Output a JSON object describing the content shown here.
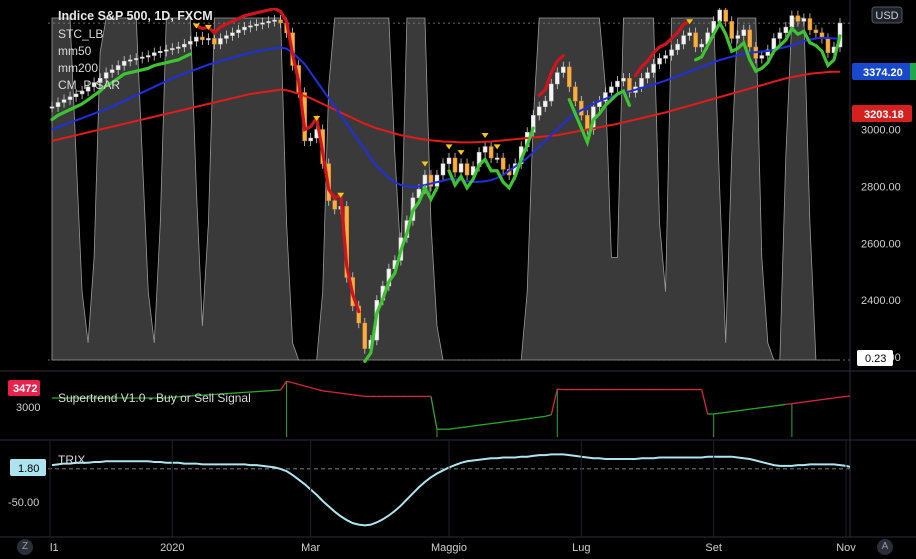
{
  "header": {
    "title": "Indice S&P 500, 1D, FXCM",
    "indicators": [
      "STC_LB",
      "mm50",
      "mm200",
      "CM_P-SAR"
    ],
    "currency": "USD"
  },
  "price_tags": {
    "last": "3374.20",
    "mm200": "3203.18",
    "stc": "0.23"
  },
  "supertrend": {
    "label": "Supertrend V1.0 - Buy or Sell Signal",
    "tag": "3472",
    "axis_label": "3000"
  },
  "trix": {
    "label": "TRIX",
    "tag": "1.80",
    "axis_label": "-50.00"
  },
  "corner": {
    "left": "Z",
    "right": "A"
  },
  "chart_data": {
    "type": "candlestick",
    "title": "Indice S&P 500, 1D, FXCM",
    "x_labels": [
      "l1",
      "2020",
      "Mar",
      "Maggio",
      "Lug",
      "Set",
      "Nov"
    ],
    "x_label_index": [
      0,
      20,
      43,
      66,
      88,
      110,
      132
    ],
    "y_ticks": [
      "3000.00",
      "2800.00",
      "2600.00",
      "2400.00",
      "2200.00"
    ],
    "y_tick_values": [
      3000,
      2800,
      2600,
      2400,
      2200
    ],
    "ylim": [
      2190,
      3420
    ],
    "price_series": [
      3080,
      3095,
      3105,
      3115,
      3125,
      3135,
      3150,
      3165,
      3180,
      3200,
      3210,
      3225,
      3240,
      3245,
      3250,
      3255,
      3260,
      3270,
      3275,
      3280,
      3285,
      3290,
      3300,
      3310,
      3325,
      3315,
      3320,
      3300,
      3320,
      3330,
      3340,
      3350,
      3360,
      3365,
      3370,
      3375,
      3380,
      3385,
      3375,
      3340,
      3225,
      3130,
      2960,
      2970,
      3000,
      2880,
      2750,
      2720,
      2730,
      2480,
      2380,
      2320,
      2230,
      2260,
      2400,
      2450,
      2510,
      2540,
      2620,
      2680,
      2760,
      2790,
      2840,
      2800,
      2840,
      2880,
      2900,
      2850,
      2880,
      2840,
      2870,
      2920,
      2940,
      2900,
      2900,
      2860,
      2840,
      2880,
      2940,
      2990,
      3050,
      3080,
      3100,
      3160,
      3200,
      3220,
      3150,
      3100,
      3050,
      3000,
      3080,
      3100,
      3130,
      3150,
      3170,
      3180,
      3130,
      3150,
      3180,
      3200,
      3230,
      3250,
      3260,
      3280,
      3300,
      3330,
      3340,
      3290,
      3300,
      3340,
      3380,
      3420,
      3380,
      3320,
      3330,
      3350,
      3290,
      3250,
      3260,
      3280,
      3320,
      3340,
      3360,
      3400,
      3380,
      3390,
      3350,
      3340,
      3320,
      3270,
      3290,
      3374
    ],
    "mm50": [
      3000,
      3008,
      3016,
      3024,
      3032,
      3040,
      3048,
      3056,
      3064,
      3072,
      3080,
      3090,
      3100,
      3110,
      3120,
      3130,
      3140,
      3150,
      3160,
      3170,
      3180,
      3188,
      3196,
      3204,
      3212,
      3220,
      3228,
      3234,
      3240,
      3246,
      3252,
      3258,
      3264,
      3270,
      3274,
      3278,
      3282,
      3286,
      3288,
      3284,
      3270,
      3250,
      3230,
      3200,
      3170,
      3140,
      3110,
      3080,
      3050,
      3020,
      2990,
      2960,
      2930,
      2900,
      2870,
      2850,
      2830,
      2815,
      2805,
      2800,
      2798,
      2800,
      2805,
      2810,
      2815,
      2820,
      2825,
      2825,
      2822,
      2818,
      2816,
      2816,
      2818,
      2822,
      2830,
      2840,
      2855,
      2870,
      2885,
      2900,
      2920,
      2940,
      2960,
      2980,
      3000,
      3020,
      3040,
      3055,
      3068,
      3078,
      3090,
      3100,
      3108,
      3116,
      3122,
      3128,
      3134,
      3140,
      3146,
      3152,
      3158,
      3165,
      3172,
      3180,
      3188,
      3196,
      3204,
      3212,
      3220,
      3228,
      3236,
      3244,
      3250,
      3256,
      3262,
      3266,
      3270,
      3272,
      3274,
      3276,
      3280,
      3285,
      3290,
      3296,
      3302,
      3310,
      3316,
      3320,
      3322,
      3322,
      3320,
      3320
    ],
    "mm200": [
      2960,
      2965,
      2970,
      2975,
      2980,
      2985,
      2990,
      2995,
      3000,
      3005,
      3010,
      3015,
      3020,
      3025,
      3030,
      3035,
      3040,
      3045,
      3050,
      3055,
      3060,
      3065,
      3070,
      3075,
      3080,
      3085,
      3090,
      3095,
      3100,
      3105,
      3110,
      3115,
      3120,
      3125,
      3128,
      3131,
      3134,
      3137,
      3140,
      3138,
      3132,
      3126,
      3118,
      3110,
      3100,
      3090,
      3080,
      3070,
      3060,
      3050,
      3040,
      3030,
      3020,
      3012,
      3004,
      2998,
      2992,
      2986,
      2980,
      2976,
      2972,
      2968,
      2965,
      2962,
      2960,
      2958,
      2957,
      2956,
      2955,
      2955,
      2955,
      2956,
      2957,
      2958,
      2960,
      2962,
      2964,
      2966,
      2968,
      2970,
      2972,
      2974,
      2976,
      2978,
      2980,
      2984,
      2988,
      2992,
      2996,
      3000,
      3004,
      3008,
      3012,
      3016,
      3020,
      3025,
      3030,
      3035,
      3040,
      3045,
      3050,
      3055,
      3060,
      3066,
      3072,
      3078,
      3084,
      3090,
      3096,
      3102,
      3108,
      3114,
      3120,
      3126,
      3132,
      3138,
      3144,
      3150,
      3156,
      3162,
      3168,
      3174,
      3180,
      3184,
      3188,
      3192,
      3196,
      3198,
      3200,
      3202,
      3203,
      3203
    ],
    "stc_ylim": [
      0,
      100
    ],
    "stc_values": [
      100,
      100,
      100,
      100,
      60,
      20,
      5,
      30,
      90,
      100,
      100,
      100,
      100,
      100,
      100,
      60,
      20,
      5,
      40,
      100,
      100,
      100,
      100,
      100,
      50,
      10,
      40,
      100,
      100,
      100,
      100,
      100,
      100,
      100,
      100,
      100,
      100,
      100,
      100,
      40,
      5,
      0,
      0,
      0,
      0,
      20,
      80,
      100,
      100,
      100,
      100,
      100,
      100,
      100,
      100,
      100,
      100,
      60,
      30,
      100,
      100,
      100,
      100,
      40,
      10,
      0,
      0,
      0,
      0,
      0,
      0,
      0,
      0,
      0,
      0,
      0,
      0,
      0,
      0,
      20,
      70,
      100,
      100,
      100,
      100,
      100,
      100,
      100,
      100,
      100,
      100,
      100,
      80,
      30,
      30,
      100,
      100,
      100,
      100,
      100,
      100,
      40,
      20,
      100,
      100,
      100,
      100,
      100,
      100,
      100,
      100,
      50,
      5,
      60,
      100,
      100,
      100,
      100,
      30,
      5,
      0,
      0,
      60,
      100,
      100,
      100,
      40,
      0,
      0,
      0,
      0,
      0
    ],
    "sar_up_ranges": [
      [
        0,
        23,
        3050
      ],
      [
        52,
        64,
        2220
      ],
      [
        66,
        80,
        2760
      ],
      [
        86,
        96,
        2980
      ],
      [
        107,
        132,
        3220
      ]
    ],
    "supertrend_ylim": [
      2800,
      3500
    ],
    "supertrend_values": [
      3250,
      3250,
      3250,
      3250,
      3250,
      3250,
      3250,
      3250,
      3250,
      3250,
      3250,
      3250,
      3250,
      3250,
      3250,
      3250,
      3250,
      3250,
      3250,
      3250,
      3260,
      3265,
      3270,
      3275,
      3280,
      3285,
      3290,
      3295,
      3300,
      3305,
      3310,
      3315,
      3320,
      3325,
      3330,
      3335,
      3340,
      3345,
      3350,
      3460,
      3440,
      3420,
      3400,
      3380,
      3360,
      3340,
      3330,
      3320,
      3310,
      3300,
      3290,
      3280,
      3270,
      3270,
      3270,
      3270,
      3270,
      3270,
      3270,
      3270,
      3270,
      3270,
      3270,
      3270,
      2860,
      2860,
      2860,
      2870,
      2880,
      2890,
      2900,
      2910,
      2920,
      2930,
      2940,
      2950,
      2960,
      2970,
      2980,
      2990,
      3000,
      3010,
      3020,
      3040,
      3360,
      3355,
      3355,
      3355,
      3355,
      3355,
      3355,
      3355,
      3355,
      3355,
      3355,
      3355,
      3355,
      3355,
      3355,
      3355,
      3355,
      3355,
      3355,
      3355,
      3355,
      3355,
      3355,
      3355,
      3355,
      3050,
      3050,
      3060,
      3070,
      3080,
      3090,
      3100,
      3110,
      3120,
      3130,
      3140,
      3150,
      3160,
      3170,
      3180,
      3190,
      3200,
      3210,
      3220,
      3230,
      3240,
      3250,
      3260,
      3270,
      3275,
      3280,
      3285
    ],
    "supertrend_flip": [
      39,
      64,
      84,
      110,
      123
    ],
    "trix_ylim": [
      -80,
      30
    ],
    "trix_values": [
      5,
      6,
      7,
      7,
      8,
      8,
      8,
      9,
      9,
      10,
      10,
      10,
      10,
      10,
      10,
      10,
      10,
      9,
      9,
      8,
      8,
      8,
      7,
      7,
      7,
      6,
      6,
      6,
      6,
      6,
      6,
      6,
      6,
      5,
      5,
      4,
      3,
      2,
      0,
      -3,
      -8,
      -14,
      -20,
      -27,
      -34,
      -42,
      -49,
      -56,
      -62,
      -67,
      -71,
      -73,
      -74,
      -73,
      -70,
      -66,
      -61,
      -55,
      -48,
      -40,
      -32,
      -24,
      -17,
      -11,
      -6,
      -2,
      2,
      5,
      8,
      10,
      11,
      12,
      13,
      14,
      14,
      15,
      15,
      15,
      16,
      16,
      17,
      18,
      18,
      19,
      19,
      19,
      18,
      17,
      16,
      15,
      14,
      14,
      13,
      13,
      13,
      13,
      13,
      13,
      14,
      14,
      14,
      15,
      15,
      15,
      15,
      15,
      15,
      15,
      15,
      16,
      16,
      16,
      16,
      16,
      15,
      14,
      13,
      11,
      9,
      7,
      5,
      4,
      4,
      4,
      5,
      5,
      6,
      6,
      6,
      6,
      6,
      5,
      4,
      2
    ],
    "trix_reference": 0
  }
}
